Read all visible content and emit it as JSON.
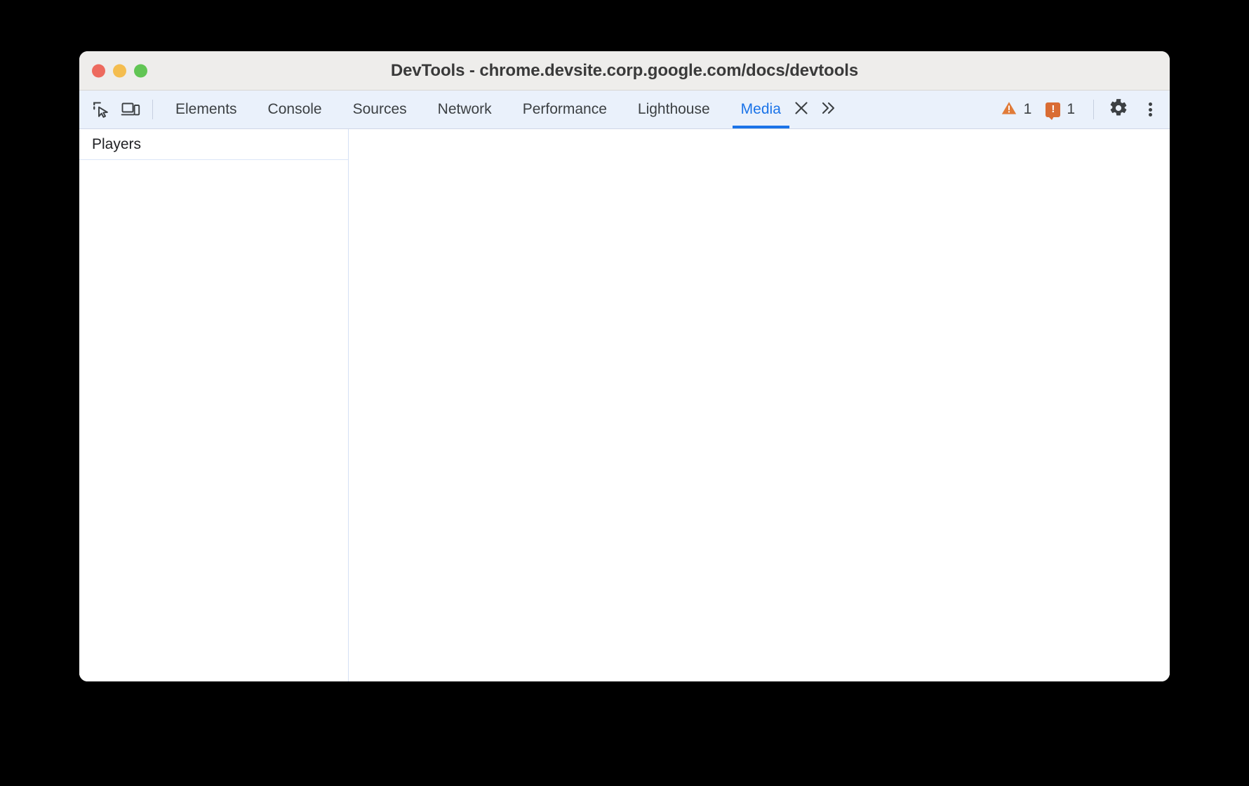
{
  "window": {
    "title": "DevTools - chrome.devsite.corp.google.com/docs/devtools",
    "traffic_lights": {
      "close_label": "close",
      "minimize_label": "minimize",
      "maximize_label": "maximize"
    }
  },
  "toolbar": {
    "inspect_icon": "inspect-element-icon",
    "device_icon": "device-toolbar-icon",
    "tabs": [
      {
        "label": "Elements",
        "active": false
      },
      {
        "label": "Console",
        "active": false
      },
      {
        "label": "Sources",
        "active": false
      },
      {
        "label": "Network",
        "active": false
      },
      {
        "label": "Performance",
        "active": false
      },
      {
        "label": "Lighthouse",
        "active": false
      },
      {
        "label": "Media",
        "active": true
      }
    ],
    "close_tab_label": "×",
    "more_tabs_label": "»",
    "warnings": {
      "icon": "warning-triangle-icon",
      "count": "1",
      "color": "#e07b39"
    },
    "issues": {
      "icon": "issues-icon",
      "count": "1",
      "color": "#d96c33",
      "glyph": "!"
    },
    "settings_icon": "gear-icon",
    "more_options_icon": "kebab-menu-icon"
  },
  "media_panel": {
    "sidebar": {
      "header": "Players",
      "items": []
    },
    "content": {
      "empty": ""
    }
  },
  "colors": {
    "accent": "#1a73e8",
    "tabbar_bg": "#eaf1fb",
    "titlebar_bg": "#eeedeb",
    "panel_bg": "#ffffff",
    "warning": "#e07b39",
    "issue": "#d96c33"
  }
}
